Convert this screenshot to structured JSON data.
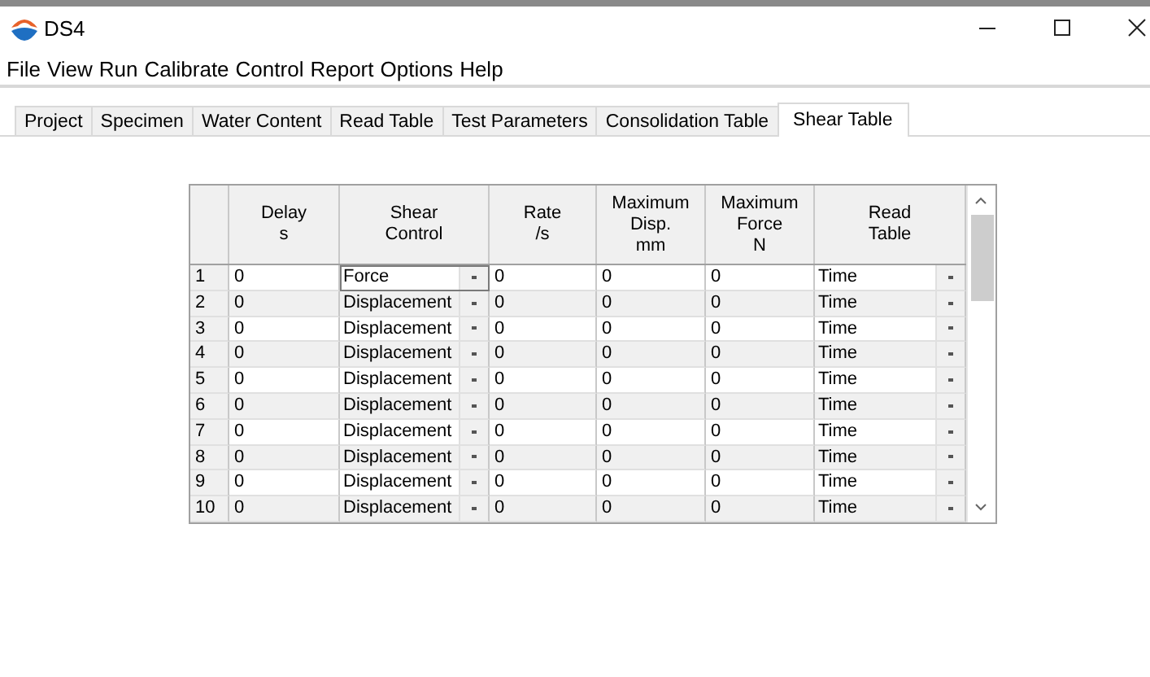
{
  "window": {
    "title": "DS4"
  },
  "menu": [
    "File",
    "View",
    "Run",
    "Calibrate",
    "Control",
    "Report",
    "Options",
    "Help"
  ],
  "tabs": [
    {
      "label": "Project",
      "selected": false
    },
    {
      "label": "Specimen",
      "selected": false
    },
    {
      "label": "Water Content",
      "selected": false
    },
    {
      "label": "Read Table",
      "selected": false
    },
    {
      "label": "Test Parameters",
      "selected": false
    },
    {
      "label": "Consolidation Table",
      "selected": false
    },
    {
      "label": "Shear Table",
      "selected": true
    }
  ],
  "table": {
    "columns": [
      [
        "Delay",
        "s"
      ],
      [
        "Shear",
        "Control"
      ],
      [
        "Rate",
        "/s"
      ],
      [
        "Maximum",
        "Disp.",
        "mm"
      ],
      [
        "Maximum",
        "Force",
        "N"
      ],
      [
        "Read",
        "Table"
      ]
    ],
    "rows": [
      {
        "number": "1",
        "delay": "0",
        "shear_control": "Force",
        "rate": "0",
        "max_disp": "0",
        "max_force": "0",
        "read_table": "Time",
        "current": true
      },
      {
        "number": "2",
        "delay": "0",
        "shear_control": "Displacement",
        "rate": "0",
        "max_disp": "0",
        "max_force": "0",
        "read_table": "Time",
        "current": false
      },
      {
        "number": "3",
        "delay": "0",
        "shear_control": "Displacement",
        "rate": "0",
        "max_disp": "0",
        "max_force": "0",
        "read_table": "Time",
        "current": false
      },
      {
        "number": "4",
        "delay": "0",
        "shear_control": "Displacement",
        "rate": "0",
        "max_disp": "0",
        "max_force": "0",
        "read_table": "Time",
        "current": false
      },
      {
        "number": "5",
        "delay": "0",
        "shear_control": "Displacement",
        "rate": "0",
        "max_disp": "0",
        "max_force": "0",
        "read_table": "Time",
        "current": false
      },
      {
        "number": "6",
        "delay": "0",
        "shear_control": "Displacement",
        "rate": "0",
        "max_disp": "0",
        "max_force": "0",
        "read_table": "Time",
        "current": false
      },
      {
        "number": "7",
        "delay": "0",
        "shear_control": "Displacement",
        "rate": "0",
        "max_disp": "0",
        "max_force": "0",
        "read_table": "Time",
        "current": false
      },
      {
        "number": "8",
        "delay": "0",
        "shear_control": "Displacement",
        "rate": "0",
        "max_disp": "0",
        "max_force": "0",
        "read_table": "Time",
        "current": false
      },
      {
        "number": "9",
        "delay": "0",
        "shear_control": "Displacement",
        "rate": "0",
        "max_disp": "0",
        "max_force": "0",
        "read_table": "Time",
        "current": false
      },
      {
        "number": "10",
        "delay": "0",
        "shear_control": "Displacement",
        "rate": "0",
        "max_disp": "0",
        "max_force": "0",
        "read_table": "Time",
        "current": false
      }
    ]
  }
}
